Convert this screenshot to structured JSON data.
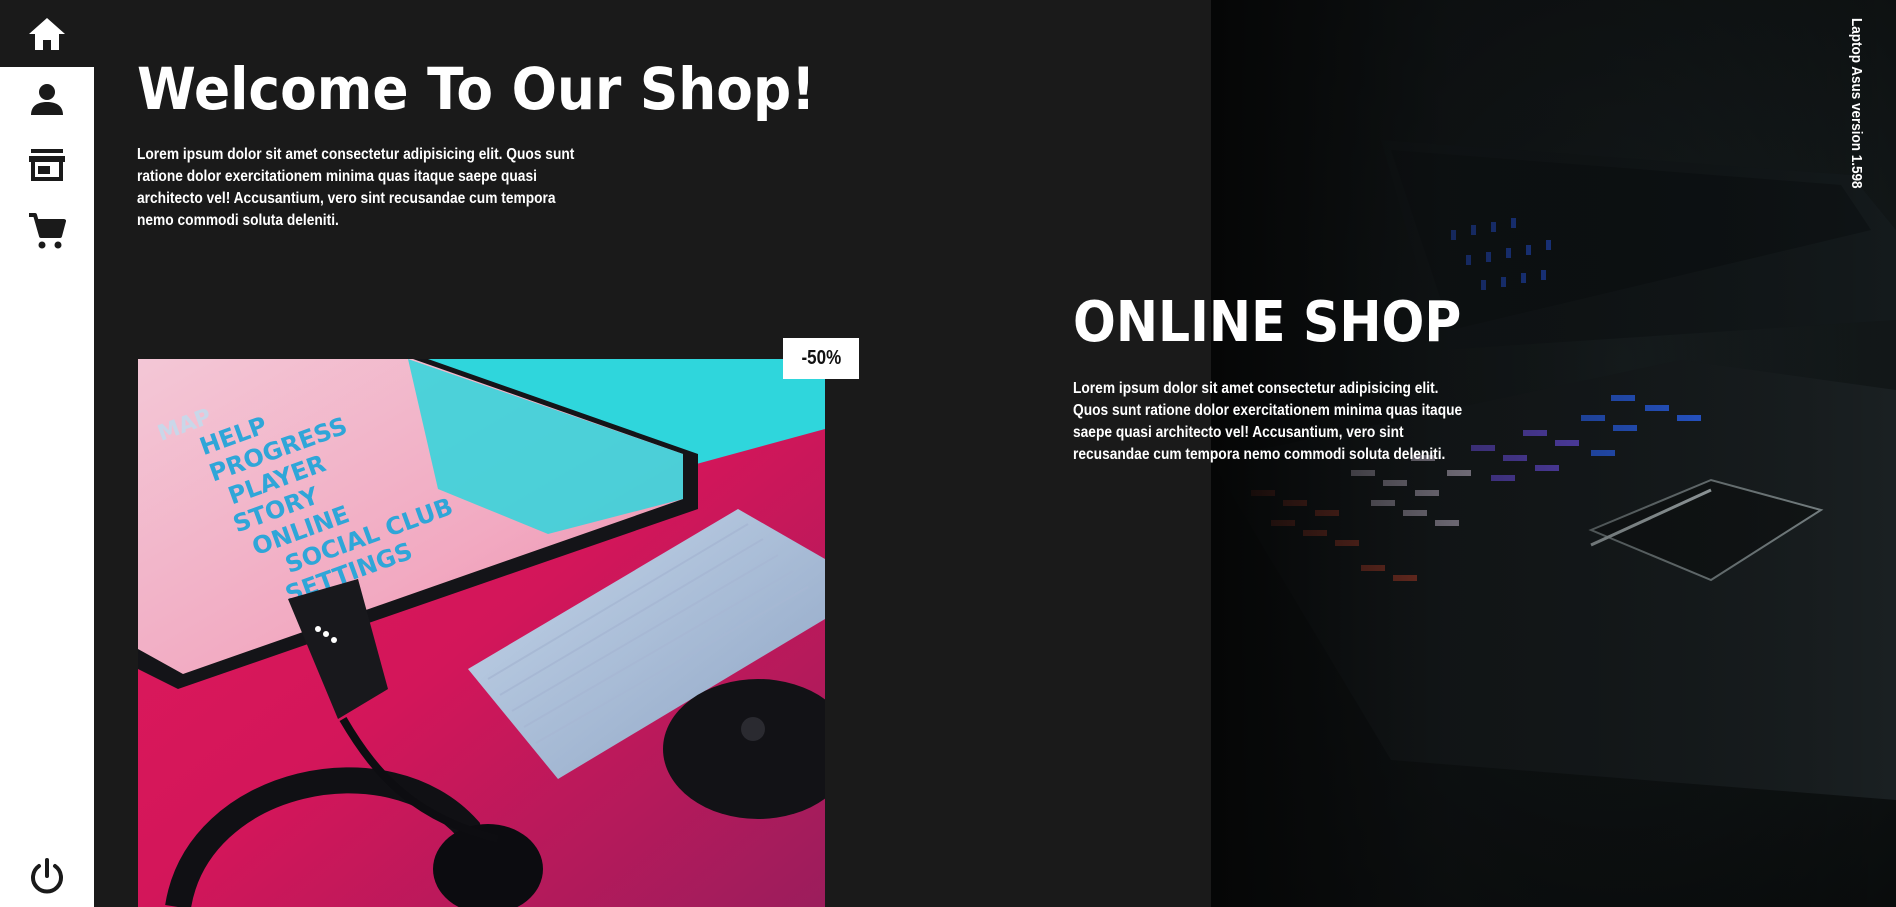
{
  "sidebar": {
    "items": [
      {
        "icon": "home-icon",
        "label": "Home"
      },
      {
        "icon": "user-icon",
        "label": "Profile"
      },
      {
        "icon": "store-icon",
        "label": "Store"
      },
      {
        "icon": "cart-icon",
        "label": "Cart"
      }
    ],
    "power_icon": "power-icon"
  },
  "hero": {
    "title": "Welcome To Our Shop!",
    "text": "Lorem ipsum dolor sit amet consectetur adipisicing elit. Quos sunt ratione dolor exercitationem minima quas itaque saepe quasi architecto vel! Accusantium, vero sint recusandae cum tempora nemo commodi soluta deleniti."
  },
  "product": {
    "discount": "-50%",
    "screen_menu": [
      "MAP",
      "HELP",
      "PROGRESS",
      "PLAYER",
      "STORY",
      "ONLINE",
      "SOCIAL CLUB",
      "SETTINGS"
    ]
  },
  "online": {
    "title": "ONLINE SHOP",
    "text": "Lorem ipsum dolor sit amet consectetur adipisicing elit. Quos sunt ratione dolor exercitationem minima quas itaque saepe quasi architecto vel! Accusantium, vero sint recusandae cum tempora nemo commodi soluta deleniti."
  },
  "version": "Laptop Asus version 1.598",
  "colors": {
    "background": "#1a1a1a",
    "sidebar": "#ffffff",
    "text": "#ffffff",
    "accent_pink": "#e0195a",
    "accent_cyan": "#2fd6dc"
  }
}
